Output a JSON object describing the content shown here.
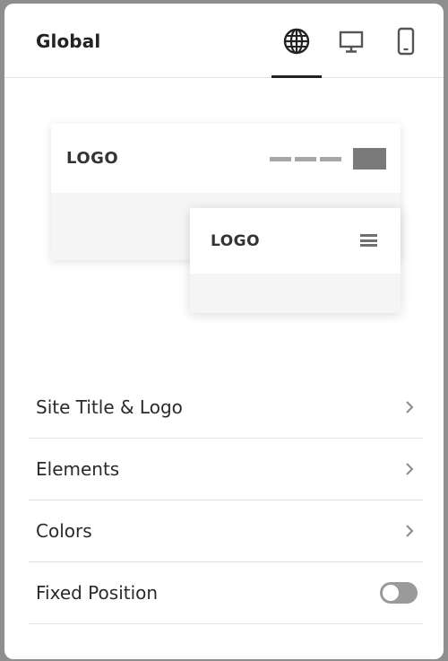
{
  "header": {
    "title": "Global",
    "tabs": [
      {
        "name": "global",
        "icon": "globe-icon",
        "active": true
      },
      {
        "name": "desktop",
        "icon": "desktop-icon",
        "active": false
      },
      {
        "name": "mobile",
        "icon": "mobile-icon",
        "active": false
      }
    ]
  },
  "preview": {
    "desktop_logo": "LOGO",
    "mobile_logo": "LOGO"
  },
  "menu": {
    "items": [
      {
        "label": "Site Title & Logo",
        "control": "chevron"
      },
      {
        "label": "Elements",
        "control": "chevron"
      },
      {
        "label": "Colors",
        "control": "chevron"
      },
      {
        "label": "Fixed Position",
        "control": "toggle",
        "value": false
      }
    ]
  },
  "colors": {
    "text": "#222222",
    "divider": "#e2e2e2",
    "toggle_off": "#9a9a9a"
  }
}
